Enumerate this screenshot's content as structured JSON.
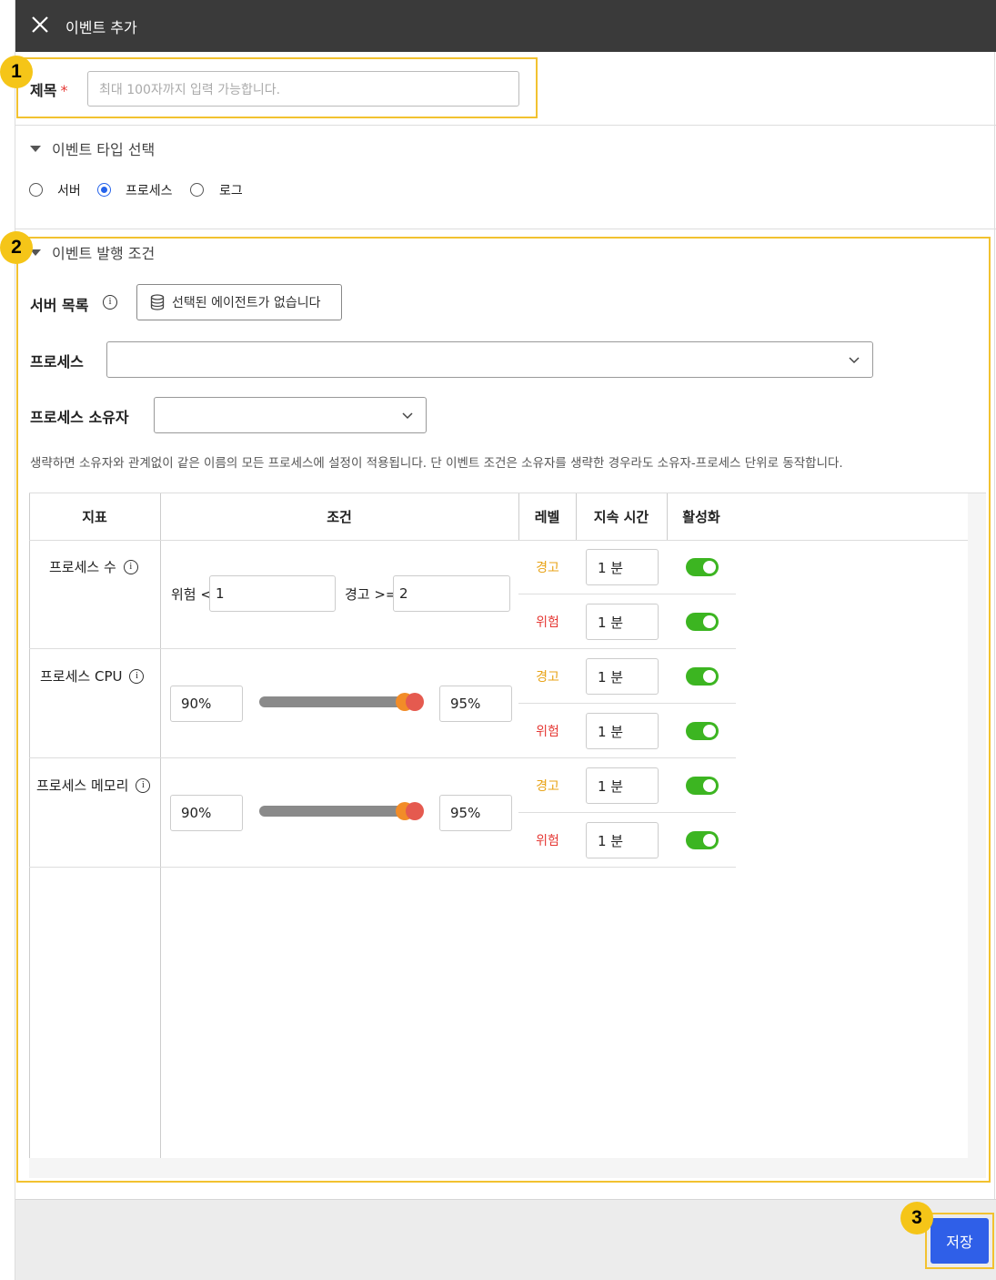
{
  "header": {
    "title": "이벤트 추가",
    "close_icon": "close-icon"
  },
  "callouts": [
    "1",
    "2",
    "3"
  ],
  "title_field": {
    "label": "제목",
    "required_mark": "*",
    "placeholder": "최대 100자까지 입력 가능합니다.",
    "value": ""
  },
  "event_type": {
    "heading": "이벤트 타입 선택",
    "options": [
      {
        "label": "서버",
        "selected": false
      },
      {
        "label": "프로세스",
        "selected": true
      },
      {
        "label": "로그",
        "selected": false
      }
    ]
  },
  "conditions": {
    "heading": "이벤트 발행 조건",
    "server_list_label": "서버 목록",
    "agent_button_label": "선택된 에이전트가 없습니다",
    "process_label": "프로세스",
    "process_value": "",
    "owner_label": "프로세스 소유자",
    "owner_value": "",
    "note": "생략하면 소유자와 관계없이 같은 이름의 모든 프로세스에 설정이 적용됩니다. 단 이벤트 조건은 소유자를 생략한 경우라도 소유자-프로세스 단위로 동작합니다."
  },
  "table": {
    "headers": [
      "지표",
      "조건",
      "레벨",
      "지속 시간",
      "활성화"
    ],
    "rows": [
      {
        "metric": "프로세스 수",
        "danger_prefix": "위험 <",
        "danger_value": "1",
        "warn_prefix": "경고 >=",
        "warn_value": "2",
        "levels": [
          {
            "level": "경고",
            "duration": "1 분",
            "enabled": true
          },
          {
            "level": "위험",
            "duration": "1 분",
            "enabled": true
          }
        ]
      },
      {
        "metric": "프로세스 CPU",
        "low": "90%",
        "high": "95%",
        "levels": [
          {
            "level": "경고",
            "duration": "1 분",
            "enabled": true
          },
          {
            "level": "위험",
            "duration": "1 분",
            "enabled": true
          }
        ]
      },
      {
        "metric": "프로세스 메모리",
        "low": "90%",
        "high": "95%",
        "levels": [
          {
            "level": "경고",
            "duration": "1 분",
            "enabled": true
          },
          {
            "level": "위험",
            "duration": "1 분",
            "enabled": true
          }
        ]
      }
    ]
  },
  "footer": {
    "save_label": "저장"
  },
  "colors": {
    "header_bg": "#3a3a3a",
    "accent": "#2f5fe8",
    "warn": "#e8a317",
    "danger": "#e53935",
    "toggle_on": "#3cb521",
    "callout": "#f5c518"
  }
}
